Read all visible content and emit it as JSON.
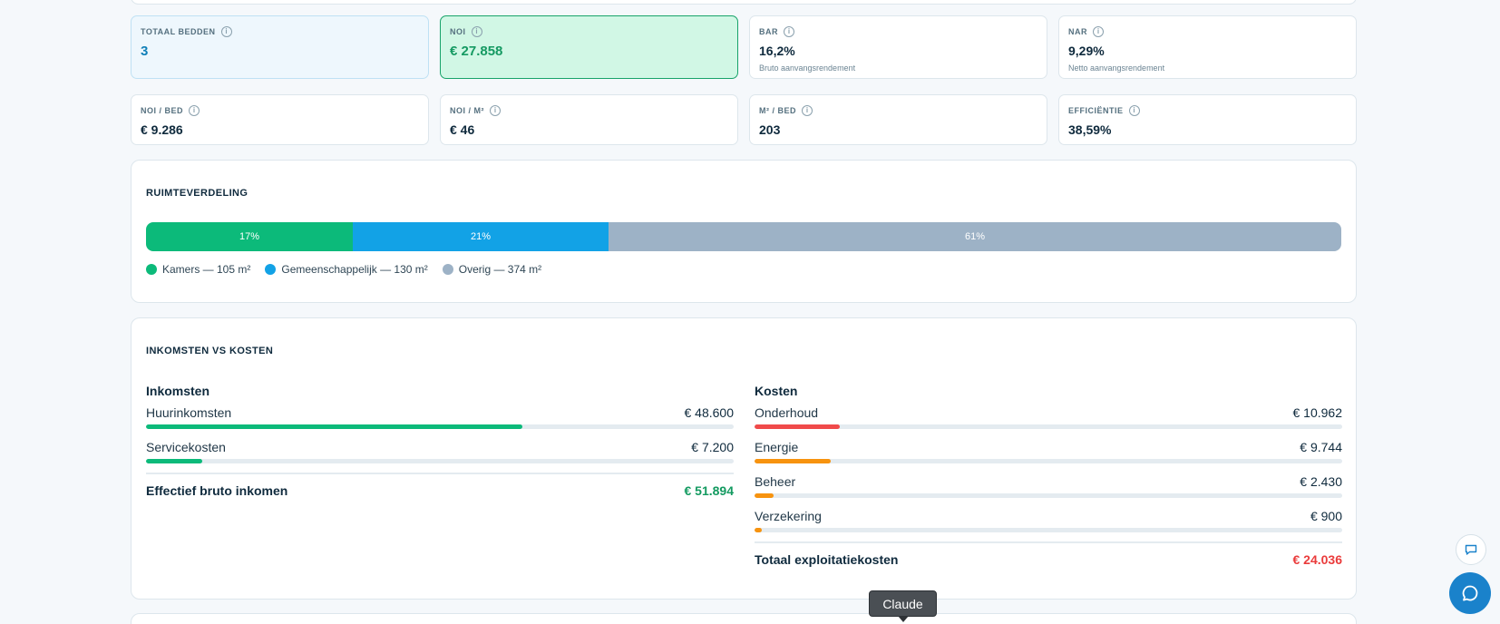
{
  "metrics_row1": [
    {
      "label": "TOTAAL BEDDEN",
      "value": "3",
      "sub": ""
    },
    {
      "label": "NOI",
      "value": "€ 27.858",
      "sub": ""
    },
    {
      "label": "BAR",
      "value": "16,2%",
      "sub": "Bruto aanvangsrendement"
    },
    {
      "label": "NAR",
      "value": "9,29%",
      "sub": "Netto aanvangsrendement"
    }
  ],
  "metrics_row2": [
    {
      "label": "NOI / BED",
      "value": "€ 9.286"
    },
    {
      "label": "NOI / M²",
      "value": "€ 46"
    },
    {
      "label": "M² / BED",
      "value": "203"
    },
    {
      "label": "EFFICIËNTIE",
      "value": "38,59%"
    }
  ],
  "ruimte": {
    "title": "RUIMTEVERDELING",
    "segments": [
      {
        "percent": "17%",
        "fraction": 0.173,
        "color": "#0cba7a"
      },
      {
        "percent": "21%",
        "fraction": 0.214,
        "color": "#12a2e6"
      },
      {
        "percent": "61%",
        "fraction": 0.613,
        "color": "#9db2c6"
      }
    ],
    "legend": [
      {
        "label": "Kamers — 105 m²",
        "color": "#0cba7a"
      },
      {
        "label": "Gemeenschappelijk — 130 m²",
        "color": "#12a2e6"
      },
      {
        "label": "Overig — 374 m²",
        "color": "#9db2c6"
      }
    ]
  },
  "ink_kosten": {
    "title": "INKOMSTEN VS KOSTEN",
    "inkomsten": {
      "title": "Inkomsten",
      "rows": [
        {
          "label": "Huurinkomsten",
          "value": "€ 48.600",
          "fraction": 0.64,
          "color": "#0cba7a"
        },
        {
          "label": "Servicekosten",
          "value": "€ 7.200",
          "fraction": 0.095,
          "color": "#0cba7a"
        }
      ],
      "total_label": "Effectief bruto inkomen",
      "total_value": "€ 51.894",
      "total_color": "#139a60"
    },
    "kosten": {
      "title": "Kosten",
      "rows": [
        {
          "label": "Onderhoud",
          "value": "€ 10.962",
          "fraction": 0.145,
          "color": "#f04a4a"
        },
        {
          "label": "Energie",
          "value": "€ 9.744",
          "fraction": 0.13,
          "color": "#f7930f"
        },
        {
          "label": "Beheer",
          "value": "€ 2.430",
          "fraction": 0.032,
          "color": "#f7930f"
        },
        {
          "label": "Verzekering",
          "value": "€ 900",
          "fraction": 0.012,
          "color": "#f7930f"
        }
      ],
      "total_label": "Totaal exploitatiekosten",
      "total_value": "€ 24.036",
      "total_color": "#ea3b3b"
    }
  },
  "tooltip": {
    "text": "Claude"
  }
}
